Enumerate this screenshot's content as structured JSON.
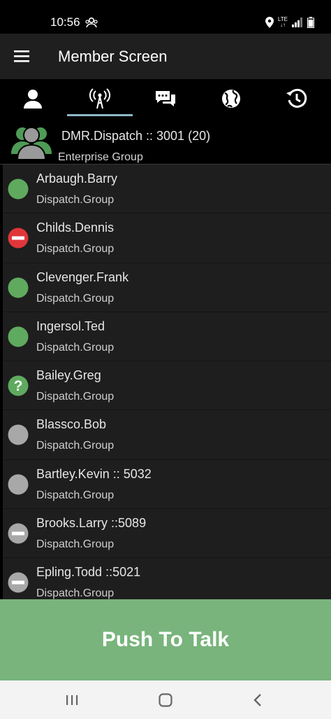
{
  "status_bar": {
    "time": "10:56",
    "network": "LTE"
  },
  "toolbar": {
    "title": "Member Screen"
  },
  "tabs": [
    {
      "id": "user",
      "icon": "person-icon"
    },
    {
      "id": "radio",
      "icon": "antenna-icon",
      "selected": true
    },
    {
      "id": "messages",
      "icon": "chat-icon"
    },
    {
      "id": "globe",
      "icon": "globe-icon"
    },
    {
      "id": "history",
      "icon": "history-icon"
    }
  ],
  "group": {
    "title": "DMR.Dispatch :: 3001 (20)",
    "subtitle": "Enterprise Group"
  },
  "members": [
    {
      "name": "Arbaugh.Barry",
      "group": "Dispatch.Group",
      "status": "online"
    },
    {
      "name": "Childs.Dennis",
      "group": "Dispatch.Group",
      "status": "busy"
    },
    {
      "name": "Clevenger.Frank",
      "group": "Dispatch.Group",
      "status": "online"
    },
    {
      "name": "Ingersol.Ted",
      "group": "Dispatch.Group",
      "status": "online"
    },
    {
      "name": "Bailey.Greg",
      "group": "Dispatch.Group",
      "status": "unknown"
    },
    {
      "name": "Blassco.Bob",
      "group": "Dispatch.Group",
      "status": "offline"
    },
    {
      "name": "Bartley.Kevin :: 5032",
      "group": "Dispatch.Group",
      "status": "offline"
    },
    {
      "name": "Brooks.Larry ::5089",
      "group": "Dispatch.Group",
      "status": "offline-busy"
    },
    {
      "name": "Epling.Todd ::5021",
      "group": "Dispatch.Group",
      "status": "offline-busy"
    }
  ],
  "ptt": {
    "label": "Push To Talk"
  },
  "colors": {
    "online": "#5faa5f",
    "busy": "#e0363a",
    "offline": "#a8a8a8",
    "ptt": "#78b47c",
    "tab_indicator": "#8fb7c8"
  }
}
